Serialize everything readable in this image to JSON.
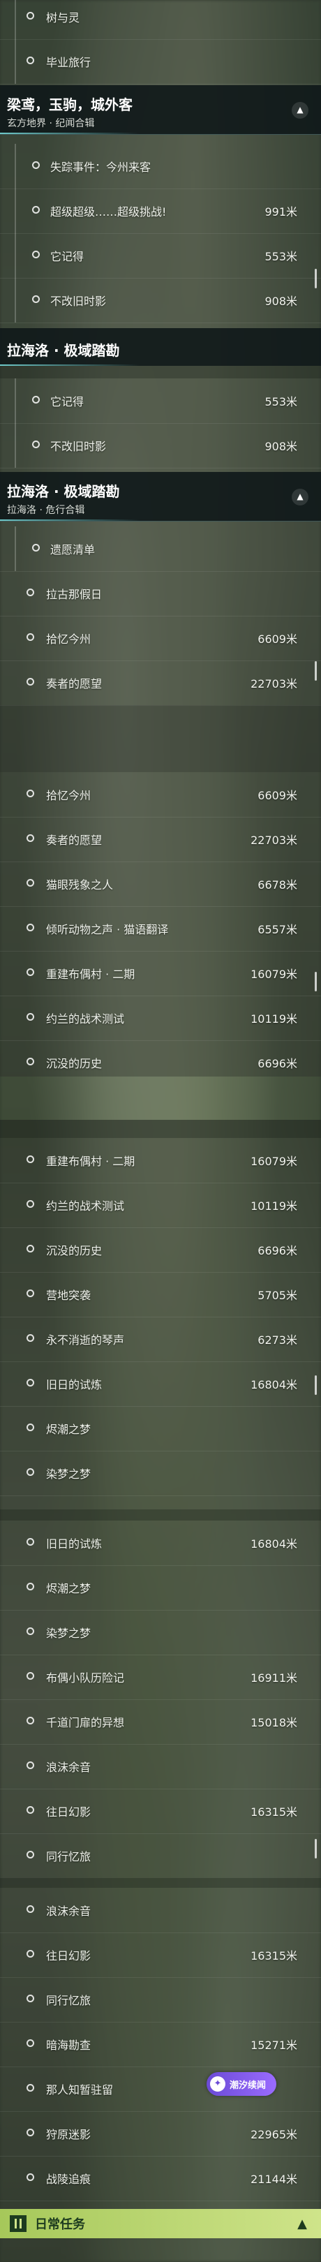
{
  "colors": {
    "accent": "#8fd6d6",
    "diamond": "#d84a6a",
    "daily": "#b7d36c"
  },
  "screens": [
    {
      "rows_top": [
        {
          "name": "树与灵",
          "dist": ""
        },
        {
          "name": "毕业旅行",
          "dist": ""
        }
      ],
      "header1": {
        "title": "梁鸢，玉驹，城外客",
        "sub": "玄方地界 · 纪闻合辑"
      },
      "rows_mid": [
        {
          "name": "失踪事件：今州来客",
          "dist": ""
        },
        {
          "name": "超级超级……超级挑战!",
          "dist": "991米"
        },
        {
          "name": "它记得",
          "dist": "553米"
        },
        {
          "name": "不改旧时影",
          "dist": "908米"
        }
      ],
      "header2": {
        "title": "拉海洛 · 极域踏勘"
      }
    }
  ],
  "s2": {
    "rows_top": [
      {
        "name": "它记得",
        "dist": "553米"
      },
      {
        "name": "不改旧时影",
        "dist": "908米"
      }
    ],
    "header": {
      "title": "拉海洛 · 极域踏勘",
      "sub": "拉海洛 · 危行合辑"
    },
    "rows": [
      {
        "name": "遗愿清单",
        "dist": ""
      },
      {
        "name": "拉古那假日",
        "dist": ""
      },
      {
        "name": "拾忆今州",
        "dist": "6609米"
      },
      {
        "name": "奏者的愿望",
        "dist": "22703米"
      }
    ]
  },
  "s3": {
    "rows": [
      {
        "name": "拾忆今州",
        "dist": "6609米"
      },
      {
        "name": "奏者的愿望",
        "dist": "22703米"
      },
      {
        "name": "猫眼残象之人",
        "dist": "6678米"
      },
      {
        "name": "倾听动物之声 · 猫语翻译",
        "dist": "6557米"
      },
      {
        "name": "重建布偶村 · 二期",
        "dist": "16079米"
      },
      {
        "name": "约兰的战术测试",
        "dist": "10119米"
      },
      {
        "name": "沉没的历史",
        "dist": "6696米"
      }
    ]
  },
  "s4": {
    "rows": [
      {
        "name": "重建布偶村 · 二期",
        "dist": "16079米"
      },
      {
        "name": "约兰的战术测试",
        "dist": "10119米"
      },
      {
        "name": "沉没的历史",
        "dist": "6696米"
      },
      {
        "name": "营地突袭",
        "dist": "5705米"
      },
      {
        "name": "永不消逝的琴声",
        "dist": "6273米"
      },
      {
        "name": "旧日的试炼",
        "dist": "16804米"
      },
      {
        "name": "烬潮之梦",
        "dist": ""
      },
      {
        "name": "染梦之梦",
        "dist": ""
      }
    ]
  },
  "s5": {
    "rows": [
      {
        "name": "旧日的试炼",
        "dist": "16804米"
      },
      {
        "name": "烬潮之梦",
        "dist": ""
      },
      {
        "name": "染梦之梦",
        "dist": ""
      },
      {
        "name": "布偶小队历险记",
        "dist": "16911米"
      },
      {
        "name": "千道门扉的异想",
        "dist": "15018米"
      },
      {
        "name": "浪沫余音",
        "dist": ""
      },
      {
        "name": "往日幻影",
        "dist": "16315米"
      },
      {
        "name": "同行忆旅",
        "dist": ""
      }
    ]
  },
  "s6": {
    "rows": [
      {
        "name": "浪沫余音",
        "dist": ""
      },
      {
        "name": "往日幻影",
        "dist": "16315米"
      },
      {
        "name": "同行忆旅",
        "dist": ""
      },
      {
        "name": "暗海勘查",
        "dist": "15271米"
      },
      {
        "name": "那人知暂驻留",
        "dist": ""
      },
      {
        "name": "狩原迷影",
        "dist": "22965米"
      },
      {
        "name": "战陵追痕",
        "dist": "21144米"
      }
    ],
    "badge": {
      "label": "潮汐续闻"
    },
    "daily": {
      "label": "日常任务"
    }
  }
}
